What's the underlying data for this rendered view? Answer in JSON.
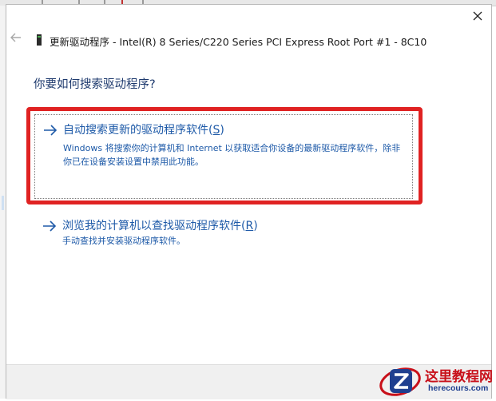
{
  "window": {
    "title": "更新驱动程序 - Intel(R) 8 Series/C220 Series PCI Express Root Port #1 - 8C10",
    "close_label": "✕",
    "back_label": "←"
  },
  "question": "你要如何搜索驱动程序?",
  "options": [
    {
      "title_text": "自动搜索更新的驱动程序软件(",
      "title_key": "S",
      "title_close": ")",
      "desc": "Windows 将搜索你的计算机和 Internet 以获取适合你设备的最新驱动程序软件，除非你已在设备安装设置中禁用此功能。"
    },
    {
      "title_text": "浏览我的计算机以查找驱动程序软件(",
      "title_key": "R",
      "title_close": ")",
      "desc": "手动查找并安装驱动程序软件。"
    }
  ],
  "watermark": {
    "name": "这里教程网",
    "url": "herecours.com"
  },
  "colors": {
    "link_blue": "#1e5aa8",
    "heading_blue": "#1e3a6e",
    "highlight_red": "#e02222",
    "watermark_red": "#c8101a",
    "watermark_blue": "#1f3f8f"
  },
  "icons": [
    "close-icon",
    "back-arrow-icon",
    "device-icon",
    "arrow-right-icon",
    "watermark-logo-icon"
  ]
}
